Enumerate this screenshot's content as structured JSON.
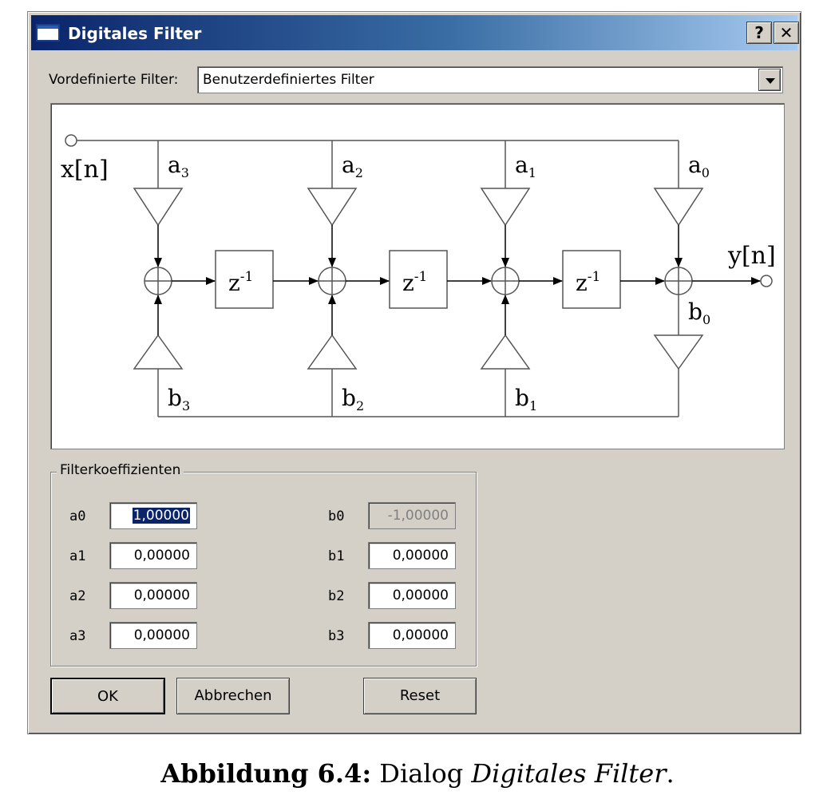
{
  "window": {
    "title": "Digitales Filter",
    "help_label": "?",
    "close_label": "✕"
  },
  "filter_select": {
    "label": "Vordefinierte Filter:",
    "selected": "Benutzerdefiniertes Filter"
  },
  "diagram": {
    "input_label": "x[n]",
    "output_label": "y[n]",
    "delay_label": "z",
    "delay_exponent": "-1",
    "a_labels": [
      {
        "base": "a",
        "sub": "3"
      },
      {
        "base": "a",
        "sub": "2"
      },
      {
        "base": "a",
        "sub": "1"
      },
      {
        "base": "a",
        "sub": "0"
      }
    ],
    "b_labels": [
      {
        "base": "b",
        "sub": "3"
      },
      {
        "base": "b",
        "sub": "2"
      },
      {
        "base": "b",
        "sub": "1"
      },
      {
        "base": "b",
        "sub": "0"
      }
    ]
  },
  "coefficients": {
    "group_title": "Filterkoeffizienten",
    "a": [
      {
        "label": "a0",
        "value": "1,00000"
      },
      {
        "label": "a1",
        "value": "0,00000"
      },
      {
        "label": "a2",
        "value": "0,00000"
      },
      {
        "label": "a3",
        "value": "0,00000"
      }
    ],
    "b": [
      {
        "label": "b0",
        "value": "-1,00000"
      },
      {
        "label": "b1",
        "value": "0,00000"
      },
      {
        "label": "b2",
        "value": "0,00000"
      },
      {
        "label": "b3",
        "value": "0,00000"
      }
    ]
  },
  "buttons": {
    "ok": "OK",
    "cancel": "Abbrechen",
    "reset": "Reset"
  },
  "caption": {
    "prefix": "Abbildung 6.4:",
    "text": " Dialog ",
    "emphasis": "Digitales Filter",
    "suffix": "."
  }
}
